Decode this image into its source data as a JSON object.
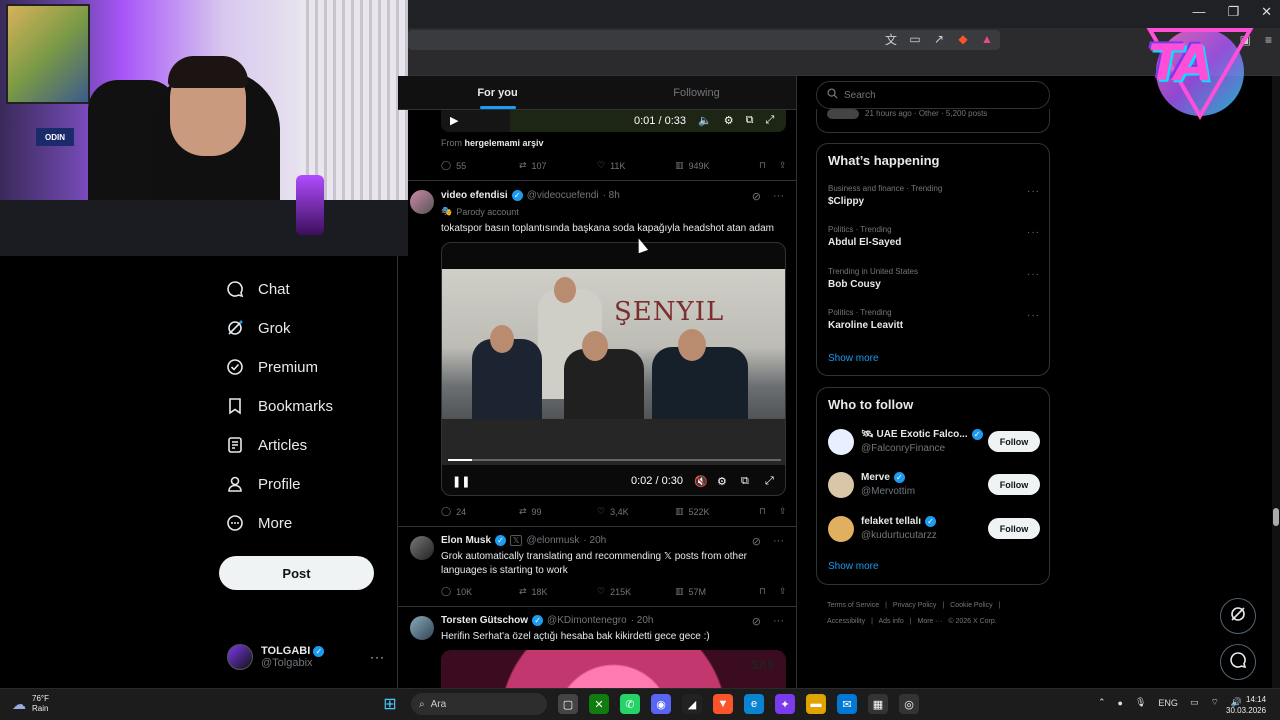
{
  "browser": {
    "window_controls": [
      "—",
      "❐",
      "✕"
    ]
  },
  "timeline_tabs": [
    {
      "label": "For you",
      "active": true
    },
    {
      "label": "Following",
      "active": false
    }
  ],
  "nav": {
    "items": [
      {
        "label": "Chat",
        "icon": "chat-icon"
      },
      {
        "label": "Grok",
        "icon": "grok-icon"
      },
      {
        "label": "Premium",
        "icon": "premium-icon"
      },
      {
        "label": "Bookmarks",
        "icon": "bookmark-icon"
      },
      {
        "label": "Articles",
        "icon": "articles-icon"
      },
      {
        "label": "Profile",
        "icon": "profile-icon"
      },
      {
        "label": "More",
        "icon": "more-icon"
      }
    ],
    "post_label": "Post",
    "profile_name": "TOLGABI",
    "profile_handle": "@Tolgabix"
  },
  "tweets": {
    "t1": {
      "video_time": "0:01 / 0:33",
      "from_prefix": "From",
      "from_name": "hergelemami arşiv",
      "replies": "55",
      "reposts": "107",
      "likes": "11K",
      "views": "949K"
    },
    "t2": {
      "name": "video efendisi",
      "handle": "@videocuefendi",
      "time": "· 8h",
      "parody": "Parody account",
      "text": "tokatspor basın toplantısında başkana soda kapağıyla headshot atan adam",
      "video_banner": "ŞENYIL",
      "video_time": "0:02 / 0:30",
      "replies": "24",
      "reposts": "99",
      "likes": "3,4K",
      "views": "522K"
    },
    "t3": {
      "name": "Elon Musk",
      "handle": "@elonmusk",
      "time": "· 20h",
      "text": "Grok automatically translating and recommending 𝕏 posts from other languages is starting to work",
      "replies": "10K",
      "reposts": "18K",
      "likes": "215K",
      "views": "57M"
    },
    "t4": {
      "name": "Torsten Gütschow",
      "handle": "@KDimontenegro",
      "time": "· 20h",
      "text": "Herifin Serhat'a özel açtığı hesaba bak kikirdetti gece gece :)",
      "video_brand": "SA9"
    }
  },
  "right": {
    "search_placeholder": "Search",
    "partial_meta": "21 hours ago · Other · 5,200 posts",
    "happening_title": "What’s happening",
    "trends": [
      {
        "meta": "Business and finance · Trending",
        "name": "$Clippy"
      },
      {
        "meta": "Politics · Trending",
        "name": "Abdul El-Sayed"
      },
      {
        "meta": "Trending in United States",
        "name": "Bob Cousy"
      },
      {
        "meta": "Politics · Trending",
        "name": "Karoline Leavitt"
      }
    ],
    "show_more": "Show more",
    "wtf_title": "Who to follow",
    "follow_label": "Follow",
    "suggestions": [
      {
        "name": "🛰 UAE Exotic Falco...",
        "handle": "@FalconryFinance",
        "color": "#e8f0ff"
      },
      {
        "name": "Merve",
        "handle": "@Mervottim",
        "color": "#d9c6a8"
      },
      {
        "name": "felaket tellalı",
        "handle": "@kudurtucutarzz",
        "color": "#e0b060"
      }
    ],
    "footer": [
      "Terms of Service",
      "|",
      "Privacy Policy",
      "|",
      "Cookie Policy",
      "|",
      "Accessibility",
      "|",
      "Ads info",
      "|",
      "More ···",
      "© 2026 X Corp."
    ]
  },
  "webcam": {
    "sign": "ODIN"
  },
  "logo": {
    "text": "TA"
  },
  "taskbar": {
    "temp": "76°F",
    "condition": "Rain",
    "search_placeholder": "Ara",
    "lang": "ENG",
    "time": "14:14",
    "date": "30.03.2026"
  }
}
